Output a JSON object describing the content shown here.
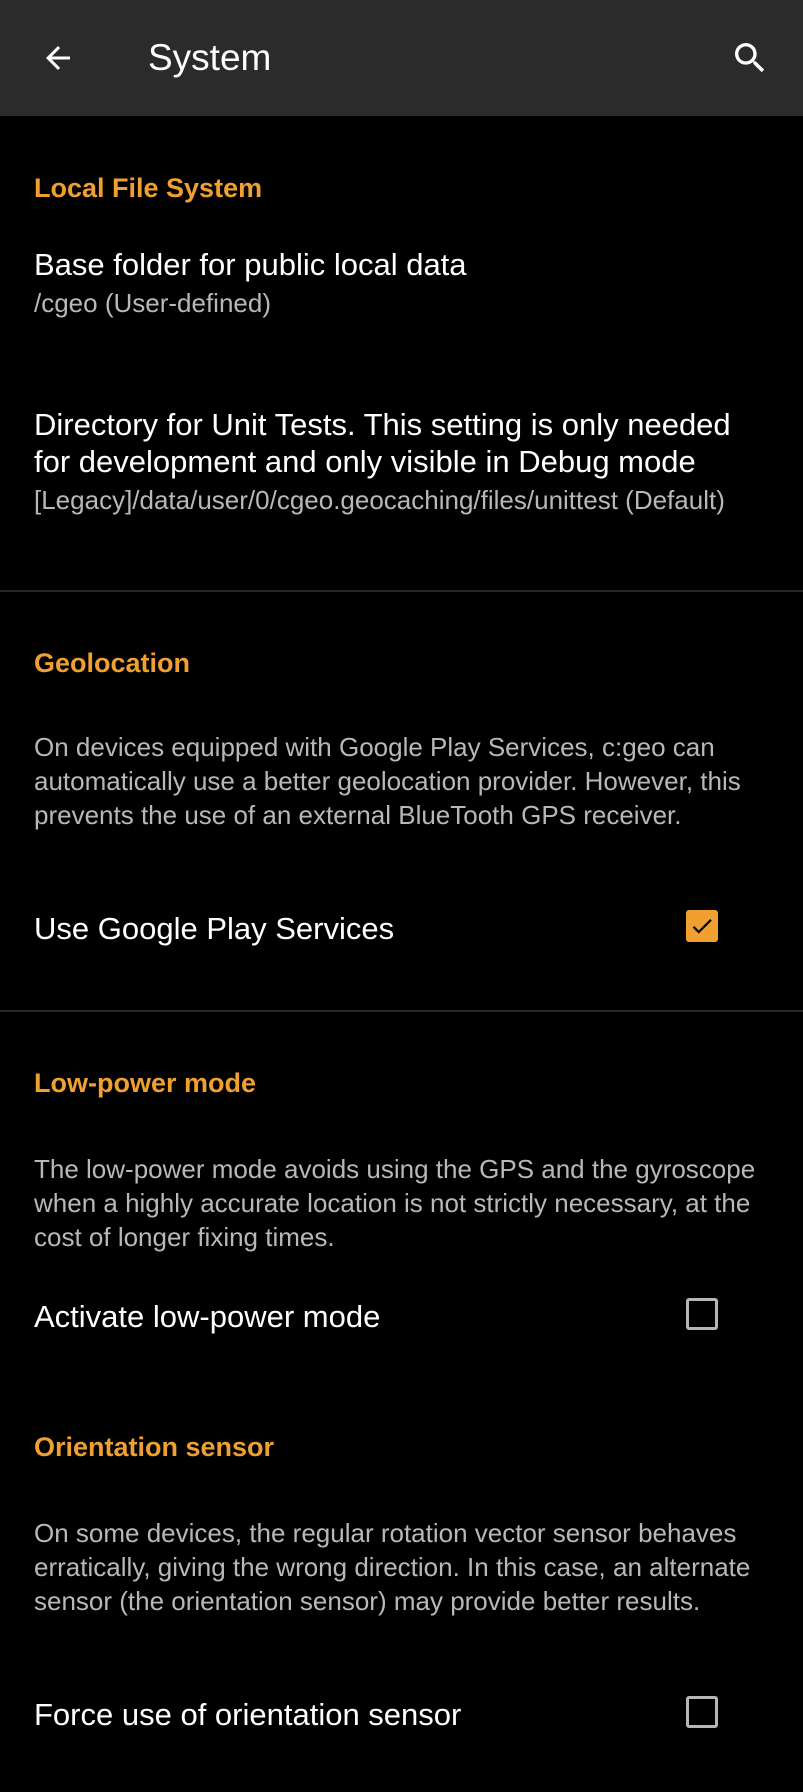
{
  "appbar": {
    "title": "System",
    "back_icon": "arrow-back-icon",
    "search_icon": "search-icon",
    "background": "#2b2b2b"
  },
  "colors": {
    "accent": "#f0a030",
    "background": "#000000",
    "summary_text": "#b8b8b8"
  },
  "sections": {
    "local_file_system": {
      "header": "Local File System",
      "base_folder": {
        "title": "Base folder for public local data",
        "summary": "/cgeo (User-defined)"
      },
      "unit_tests": {
        "title": "Directory for Unit Tests. This setting is only needed for development and only visible in Debug mode",
        "summary": "[Legacy]/data/user/0/cgeo.geocaching/files/unittest (Default)"
      }
    },
    "geolocation": {
      "header": "Geolocation",
      "description": "On devices equipped with Google Play Services, c:geo can automatically use a better geolocation provider. However, this prevents the use of an external BlueTooth GPS receiver.",
      "use_play_services": {
        "label": "Use Google Play Services",
        "checked": true
      }
    },
    "low_power": {
      "header": "Low-power mode",
      "description": "The low-power mode avoids using the GPS and the gyroscope when a highly accurate location is not strictly necessary, at the cost of longer fixing times.",
      "activate": {
        "label": "Activate low-power mode",
        "checked": false
      }
    },
    "orientation": {
      "header": "Orientation sensor",
      "description": "On some devices, the regular rotation vector sensor behaves erratically, giving the wrong direction. In this case, an alternate sensor (the orientation sensor) may provide better results.",
      "force": {
        "label": "Force use of orientation sensor",
        "checked": false
      }
    }
  }
}
